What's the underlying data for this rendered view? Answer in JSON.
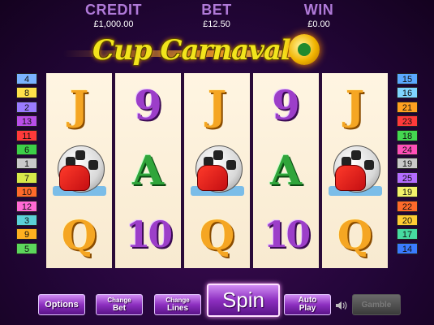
{
  "header": {
    "credit_label": "CREDIT",
    "credit_value": "£1,000.00",
    "bet_label": "BET",
    "bet_value": "£12.50",
    "win_label": "WIN",
    "win_value": "£0.00"
  },
  "logo": {
    "text": "Cup Carnaval"
  },
  "paylines_left": [
    {
      "n": "4",
      "color": "#7ab3ff"
    },
    {
      "n": "8",
      "color": "#ffe14a"
    },
    {
      "n": "2",
      "color": "#9a7bff"
    },
    {
      "n": "13",
      "color": "#b94ee8"
    },
    {
      "n": "11",
      "color": "#ff3a3a"
    },
    {
      "n": "6",
      "color": "#3ccf48"
    },
    {
      "n": "1",
      "color": "#c9c9c9"
    },
    {
      "n": "7",
      "color": "#d7e84a"
    },
    {
      "n": "10",
      "color": "#ff6a2a"
    },
    {
      "n": "12",
      "color": "#ff6ad5"
    },
    {
      "n": "3",
      "color": "#5bd0d8"
    },
    {
      "n": "9",
      "color": "#ffb020"
    },
    {
      "n": "5",
      "color": "#5cd65c"
    }
  ],
  "paylines_right": [
    {
      "n": "15",
      "color": "#5aa8ff"
    },
    {
      "n": "16",
      "color": "#7fd4ff"
    },
    {
      "n": "21",
      "color": "#ffa020"
    },
    {
      "n": "23",
      "color": "#ff3a3a"
    },
    {
      "n": "18",
      "color": "#44d850"
    },
    {
      "n": "24",
      "color": "#ff4fb8"
    },
    {
      "n": "19",
      "color": "#c9c9c9"
    },
    {
      "n": "25",
      "color": "#b46cff"
    },
    {
      "n": "19",
      "color": "#f3f36a"
    },
    {
      "n": "22",
      "color": "#ff6a2a"
    },
    {
      "n": "20",
      "color": "#ffcc33"
    },
    {
      "n": "17",
      "color": "#46dba0"
    },
    {
      "n": "14",
      "color": "#3a7bff"
    }
  ],
  "reels": [
    [
      {
        "sym": "J",
        "kind": "card",
        "color": "orange"
      },
      {
        "sym": "ball-glove",
        "kind": "icon"
      },
      {
        "sym": "Q",
        "kind": "card",
        "color": "orange"
      }
    ],
    [
      {
        "sym": "9",
        "kind": "card",
        "color": "purple"
      },
      {
        "sym": "A",
        "kind": "card",
        "color": "green"
      },
      {
        "sym": "10",
        "kind": "card",
        "color": "purple"
      }
    ],
    [
      {
        "sym": "J",
        "kind": "card",
        "color": "orange"
      },
      {
        "sym": "ball-glove",
        "kind": "icon"
      },
      {
        "sym": "Q",
        "kind": "card",
        "color": "orange"
      }
    ],
    [
      {
        "sym": "9",
        "kind": "card",
        "color": "purple"
      },
      {
        "sym": "A",
        "kind": "card",
        "color": "green"
      },
      {
        "sym": "10",
        "kind": "card",
        "color": "purple"
      }
    ],
    [
      {
        "sym": "J",
        "kind": "card",
        "color": "orange"
      },
      {
        "sym": "ball-glove",
        "kind": "icon"
      },
      {
        "sym": "Q",
        "kind": "card",
        "color": "orange"
      }
    ]
  ],
  "controls": {
    "options": "Options",
    "change_bet_1": "Change",
    "change_bet_2": "Bet",
    "change_lines_1": "Change",
    "change_lines_2": "Lines",
    "spin": "Spin",
    "autoplay_1": "Auto",
    "autoplay_2": "Play",
    "gamble": "Gamble",
    "sound_icon": "speaker-icon"
  }
}
